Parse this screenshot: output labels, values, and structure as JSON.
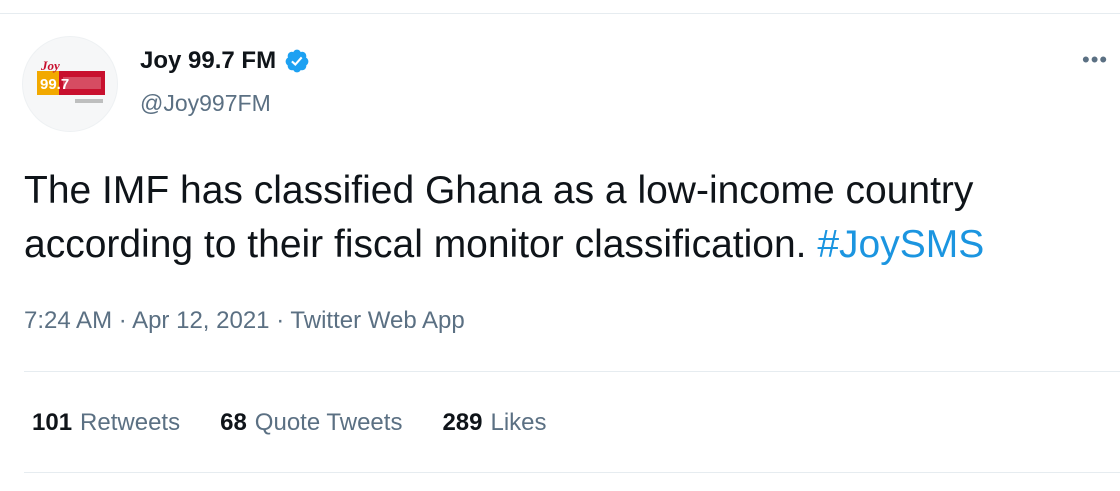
{
  "account": {
    "display_name": "Joy 99.7 FM",
    "handle": "@Joy997FM",
    "verified": true,
    "avatar_logo_text": "Joy 99.7"
  },
  "tweet": {
    "text_line1": "The IMF has classified Ghana as a low-income country",
    "text_line2": "according to their fiscal monitor classification.",
    "hashtag": "#JoySMS",
    "time": "7:24 AM",
    "separator": "·",
    "date": "Apr 12, 2021",
    "source": "Twitter Web App"
  },
  "stats": {
    "retweets_count": "101",
    "retweets_label": "Retweets",
    "quote_count": "68",
    "quote_label": "Quote Tweets",
    "likes_count": "289",
    "likes_label": "Likes"
  },
  "icons": {
    "verified": "verified-badge-icon",
    "more": "more-options-icon"
  },
  "colors": {
    "accent": "#1b95e0",
    "secondary_text": "#5b7083",
    "verified": "#1da1f2"
  }
}
